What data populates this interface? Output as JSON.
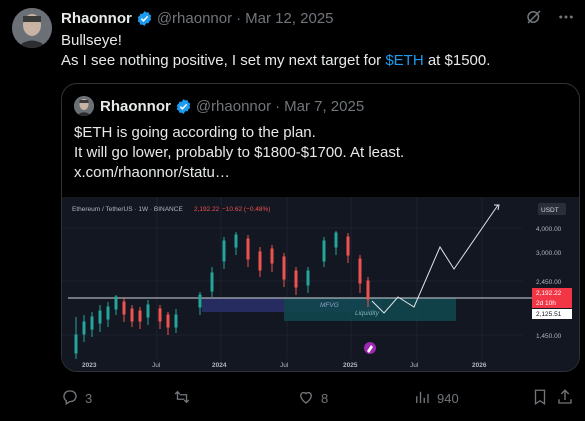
{
  "post": {
    "author_name": "Rhaonnor",
    "author_handle": "@rhaonnor",
    "date": "Mar 12, 2025",
    "lines": [
      "Bullseye!"
    ],
    "line2_before": "As I see nothing positive, I set my next target for ",
    "cashtag": "$ETH",
    "line2_after": " at $1500."
  },
  "quoted": {
    "author_name": "Rhaonnor",
    "author_handle": "@rhaonnor",
    "date": "Mar 7, 2025",
    "lines": [
      "$ETH is going according to the plan.",
      "It will go lower, probably to $1800-$1700. At least.",
      "x.com/rhaonnor/statu…"
    ]
  },
  "chart": {
    "header": "Ethereum / TetherUS · 1W · BINANCE",
    "price_header": "2,192.22",
    "change_header": "−10.62 (−0.48%)",
    "currency": "USDT",
    "y_ticks": [
      "4,000.00",
      "3,000.00",
      "2,450.00",
      "1,450.00"
    ],
    "x_ticks": [
      "2023",
      "Jul",
      "2024",
      "Jul",
      "2025",
      "Jul",
      "2026"
    ],
    "price_label": "2,192.22",
    "countdown_label": "2d 10h",
    "level_label": "2,125.51",
    "zone1_label": "MFVG",
    "zone2_label": "Liquidity",
    "colors": {
      "up": "#26a69a",
      "down": "#ef5350",
      "price_tag": "#f23645",
      "zone_blue": "#2a2f6b",
      "zone_teal": "#12464c"
    }
  },
  "actions": {
    "replies": "3",
    "retweets": "",
    "likes": "8",
    "views": "940"
  }
}
